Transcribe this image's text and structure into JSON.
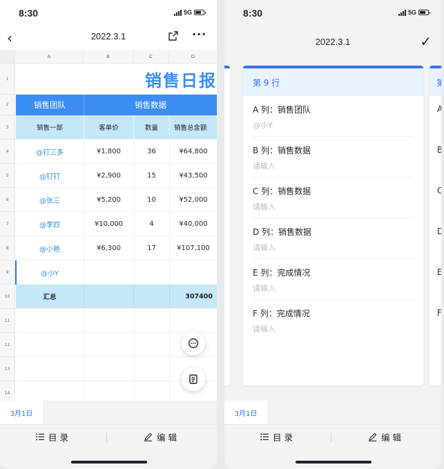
{
  "status": {
    "time": "8:30",
    "network": "5G"
  },
  "left": {
    "title": "2022.3.1",
    "columns": [
      "A",
      "B",
      "C",
      "D"
    ],
    "rows": [
      "1",
      "2",
      "3",
      "4",
      "5",
      "6",
      "7",
      "8",
      "9",
      "10",
      "11",
      "12",
      "13",
      "14"
    ],
    "sheet_title": "销售日报",
    "header_team": "销售团队",
    "header_data": "销售数据",
    "subheaders": [
      "销售一部",
      "客单价",
      "数量",
      "销售总金额"
    ],
    "data_rows": [
      [
        "@钉三多",
        "¥1,800",
        "36",
        "¥64,800"
      ],
      [
        "@钉钉",
        "¥2,900",
        "15",
        "¥43,500"
      ],
      [
        "@张三",
        "¥5,200",
        "10",
        "¥52,000"
      ],
      [
        "@李四",
        "¥10,000",
        "4",
        "¥40,000"
      ],
      [
        "@小艳",
        "¥6,300",
        "17",
        "¥107,100"
      ],
      [
        "@小Y",
        "",
        "",
        ""
      ]
    ],
    "total_label": "汇总",
    "total_value": "307400",
    "tab_label": "3月1日",
    "toc_label": "目 录",
    "edit_label": "编 辑"
  },
  "right": {
    "title": "2022.3.1",
    "card_title": "第 9 行",
    "fields": [
      {
        "label": "A 列：销售团队",
        "value": "@小Y"
      },
      {
        "label": "B 列：销售数据",
        "value": "请输入"
      },
      {
        "label": "C 列：销售数据",
        "value": "请输入"
      },
      {
        "label": "D 列：销售数据",
        "value": "请输入"
      },
      {
        "label": "E 列：完成情况",
        "value": "请输入"
      },
      {
        "label": "F 列：完成情况",
        "value": "请输入"
      }
    ],
    "side_letters": [
      "A",
      "B",
      "C",
      "D",
      "E",
      "F"
    ],
    "side_head": "第",
    "tab_label": "3月1日",
    "toc_label": "目 录",
    "edit_label": "编 辑"
  },
  "colors": {
    "accent": "#3370ff",
    "header_blue": "#3b8df2",
    "header_light": "#c5e7f7",
    "title_blue": "#3a8ef0"
  }
}
